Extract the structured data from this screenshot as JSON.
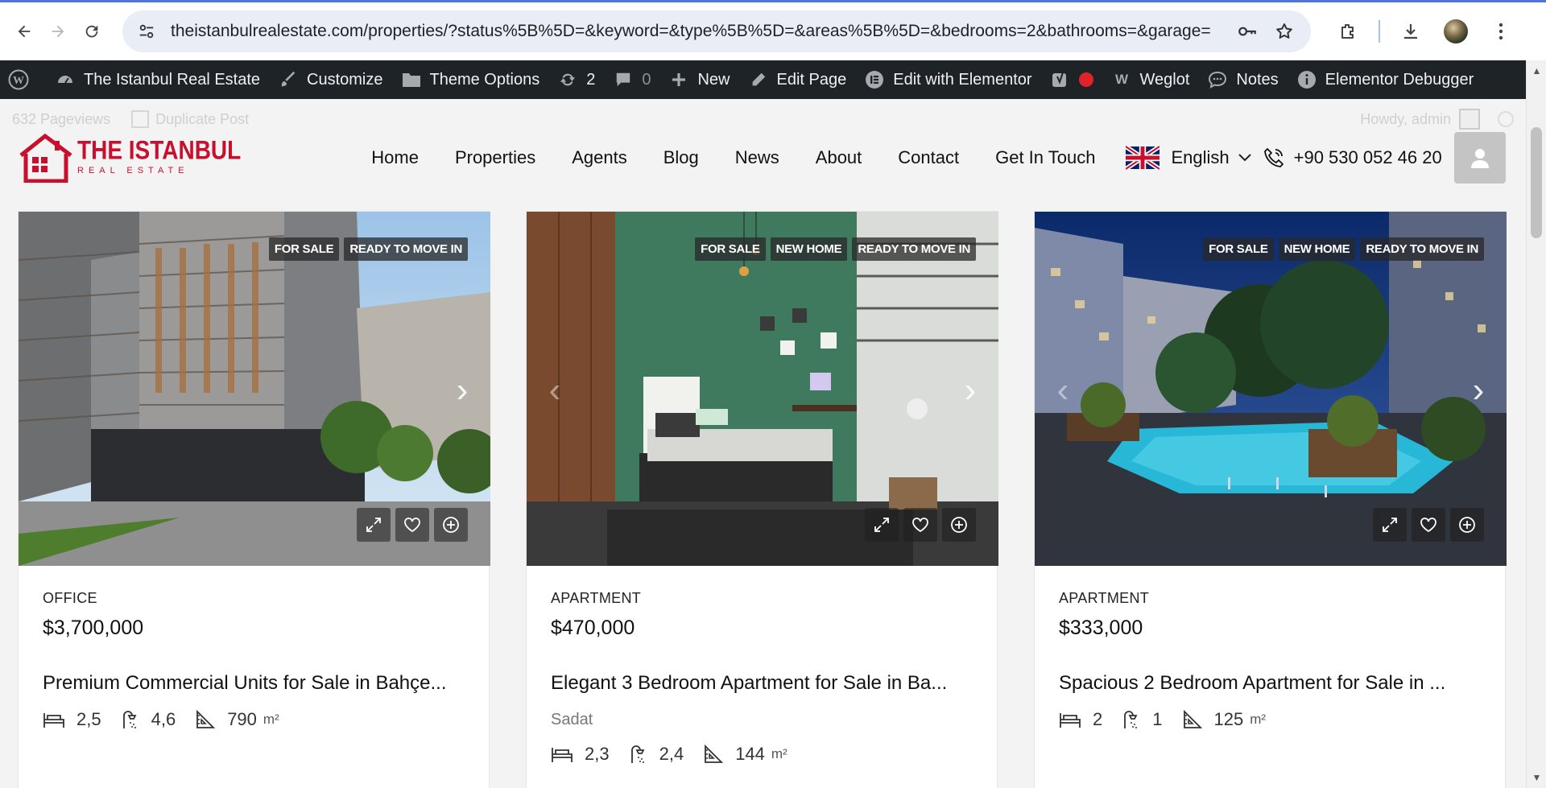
{
  "browser": {
    "url": "theistanbulrealestate.com/properties/?status%5B%5D=&keyword=&type%5B%5D=&areas%5B%5D=&bedrooms=2&bathrooms=&garage="
  },
  "adminbar": {
    "site_name": "The Istanbul Real Estate",
    "customize": "Customize",
    "theme_options": "Theme Options",
    "updates_count": "2",
    "comments_count": "0",
    "new": "New",
    "edit_page": "Edit Page",
    "edit_elementor": "Edit with Elementor",
    "weglot": "Weglot",
    "notes": "Notes",
    "debugger": "Elementor Debugger"
  },
  "ghostbar": {
    "pageviews": "632 Pageviews",
    "duplicate": "Duplicate Post",
    "howdy": "Howdy, admin"
  },
  "logo": {
    "line1": "THE ISTANBUL",
    "line2": "REAL ESTATE"
  },
  "nav": {
    "items": [
      "Home",
      "Properties",
      "Agents",
      "Blog",
      "News",
      "About",
      "Contact",
      "Get In Touch"
    ],
    "language": "English",
    "phone": "+90 530 052 46 20"
  },
  "cards": [
    {
      "badges": [
        "FOR SALE",
        "READY TO MOVE IN"
      ],
      "type": "OFFICE",
      "price": "$3,700,000",
      "title": "Premium Commercial Units for Sale in Bahçe...",
      "location": "",
      "beds": "2,5",
      "baths": "4,6",
      "size": "790",
      "unit": "m²"
    },
    {
      "badges": [
        "FOR SALE",
        "NEW HOME",
        "READY TO MOVE IN"
      ],
      "type": "APARTMENT",
      "price": "$470,000",
      "title": "Elegant 3 Bedroom Apartment for Sale in Ba...",
      "location": "Sadat",
      "beds": "2,3",
      "baths": "2,4",
      "size": "144",
      "unit": "m²"
    },
    {
      "badges": [
        "FOR SALE",
        "NEW HOME",
        "READY TO MOVE IN"
      ],
      "type": "APARTMENT",
      "price": "$333,000",
      "title": "Spacious 2 Bedroom Apartment for Sale in ...",
      "location": "",
      "beds": "2",
      "baths": "1",
      "size": "125",
      "unit": "m²"
    }
  ],
  "colors": {
    "brand_red": "#c8102e",
    "adminbar_bg": "#1d2327"
  }
}
